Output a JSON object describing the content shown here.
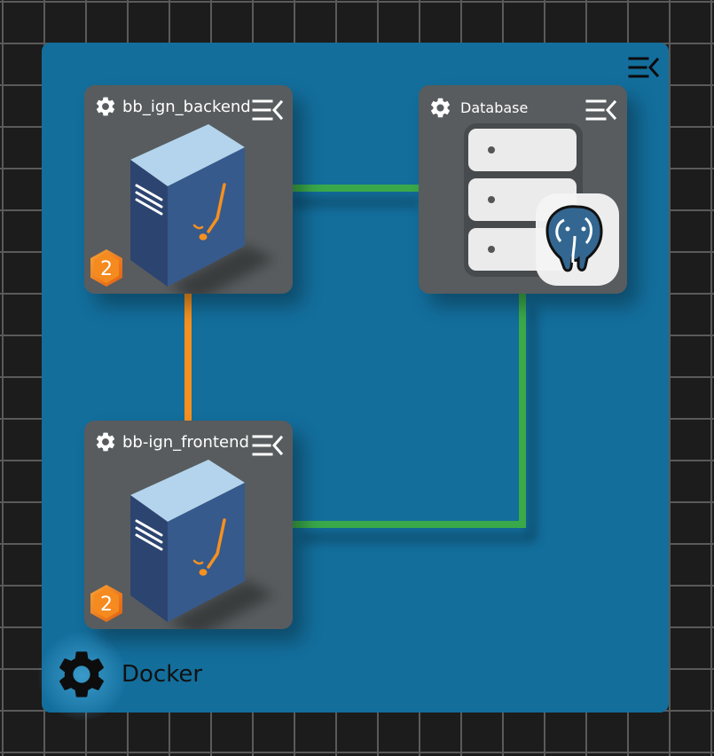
{
  "canvas": {
    "background": "#1c1c1c",
    "grid_color": "#5a5a5a",
    "container_color": "#136e9c"
  },
  "container": {
    "label": "Docker",
    "icon": "gear-icon",
    "menu_icon": "collapse-menu-icon"
  },
  "nodes": [
    {
      "id": "backend",
      "label": "bb_ign_backend",
      "icon": "server-icon",
      "badge": "2",
      "menu_icon": "collapse-menu-icon"
    },
    {
      "id": "database",
      "label": "Database",
      "icon": "database-icon",
      "logo": "postgresql-elephant-icon",
      "menu_icon": "collapse-menu-icon"
    },
    {
      "id": "frontend",
      "label": "bb-ign_frontend",
      "icon": "server-icon",
      "badge": "2",
      "menu_icon": "collapse-menu-icon"
    }
  ],
  "connections": [
    {
      "from": "backend",
      "to": "database",
      "color": "#3aa94a"
    },
    {
      "from": "backend",
      "to": "frontend",
      "color": "#f7901e"
    },
    {
      "from": "frontend",
      "to": "database",
      "color": "#3aa94a"
    }
  ]
}
